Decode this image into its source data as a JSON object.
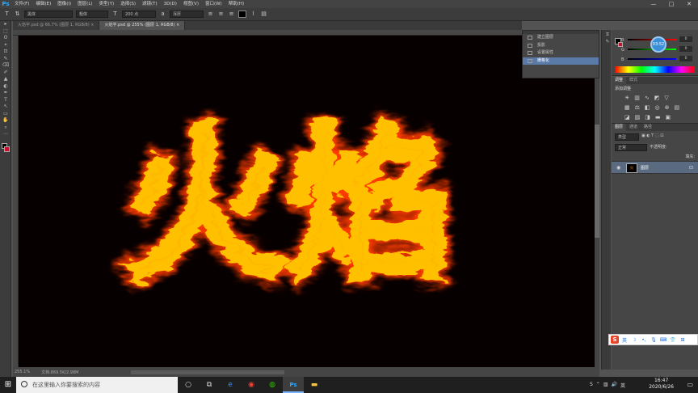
{
  "app": {
    "logo": "Ps"
  },
  "menu": [
    "文件(F)",
    "编辑(E)",
    "图像(I)",
    "图层(L)",
    "类型(Y)",
    "选择(S)",
    "滤镜(T)",
    "3D(D)",
    "视图(V)",
    "窗口(W)",
    "帮助(H)"
  ],
  "window_controls": [
    "—",
    "□",
    "✕"
  ],
  "options": {
    "font": "黑体",
    "style": "粗体",
    "size": "200 点",
    "aa": "浑厚",
    "tool_glyph": "T"
  },
  "tabs": [
    "火焰字.psd @ 66.7% (图层 1, RGB/8) ×",
    "火焰字.psd @ 255% (图层 1, RGB/8) ×"
  ],
  "tools": [
    "▸",
    "⬚",
    "ʘ",
    "⌖",
    "⊡",
    "✎",
    "⌫",
    "✐",
    "▲",
    "◐",
    "✒",
    "T",
    "↖",
    "▭",
    "✋",
    "⌕",
    "⋯"
  ],
  "canvas": {
    "text": "火焰",
    "colors": {
      "core": "#ffb800",
      "edge": "#ff3a00",
      "bg": "#070000"
    }
  },
  "status": {
    "zoom": "255.1%",
    "doc": "文档:869.5K/2.98M"
  },
  "history": {
    "items": [
      "建立图层",
      "投影",
      "设置属性",
      "栅格化"
    ],
    "selected": 3
  },
  "color": {
    "r": "0",
    "g": "0",
    "b": "0",
    "badge": "03:52"
  },
  "adjustments": {
    "tabs": [
      "调整",
      "样式"
    ],
    "title": "添加调整"
  },
  "layers": {
    "tabs": [
      "图层",
      "通道",
      "路径"
    ],
    "kind": "类型",
    "blend": "正常",
    "opacity_label": "不透明度:",
    "fill_label": "填充:",
    "layer_name": "图层"
  },
  "taskbar": {
    "search_placeholder": "在这里输入你要搜索的内容",
    "time": "16:47",
    "date": "2020/6/26"
  },
  "ime": {
    "lang": "英"
  }
}
